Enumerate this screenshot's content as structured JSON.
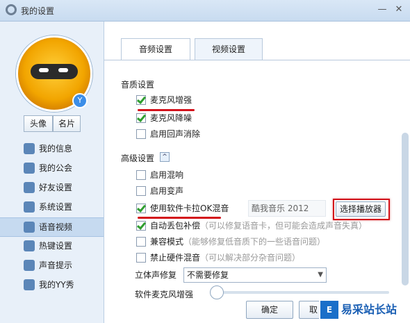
{
  "window": {
    "title": "我的设置",
    "minimize_glyph": "—",
    "close_glyph": "✕"
  },
  "sidebar": {
    "avatar_badge": "Y",
    "buttons": [
      "头像",
      "名片"
    ],
    "items": [
      {
        "label": "我的信息",
        "icon": "user-card-icon"
      },
      {
        "label": "我的公会",
        "icon": "flag-icon"
      },
      {
        "label": "好友设置",
        "icon": "friends-icon"
      },
      {
        "label": "系统设置",
        "icon": "gear-icon"
      },
      {
        "label": "语音视频",
        "icon": "webcam-icon"
      },
      {
        "label": "热键设置",
        "icon": "keyboard-icon"
      },
      {
        "label": "声音提示",
        "icon": "music-note-icon"
      },
      {
        "label": "我的YY秀",
        "icon": "shirt-icon"
      }
    ],
    "active_index": 4
  },
  "tabs": [
    "音频设置",
    "视频设置"
  ],
  "sections": {
    "quality": {
      "title": "音质设置",
      "options": [
        {
          "label": "麦克风增强",
          "checked": true
        },
        {
          "label": "麦克风降噪",
          "checked": true
        },
        {
          "label": "启用回声消除",
          "checked": false
        }
      ]
    },
    "advanced": {
      "title": "高级设置",
      "toggle_glyph": "^",
      "options": [
        {
          "label": "启用混响",
          "checked": false
        },
        {
          "label": "启用变声",
          "checked": false
        },
        {
          "label": "使用软件卡拉OK混音",
          "checked": true
        },
        {
          "label": "自动丢包补偿",
          "hint": "（可以修复语音卡，但可能会造成声音失真）",
          "checked": true
        },
        {
          "label": "兼容模式",
          "hint": "（能够修复低音质下的一些语音问题）",
          "checked": false
        },
        {
          "label": "禁止硬件混音",
          "hint": "（可以解决部分杂音问题）",
          "checked": false
        }
      ],
      "player_value": "酷我音乐 2012",
      "choose_player_button": "选择播放器",
      "stereo_label": "立体声修复",
      "stereo_value": "不需要修复",
      "mic_boost_label": "软件麦克风增强"
    }
  },
  "footer": {
    "ok": "确定",
    "cancel": "取"
  },
  "watermark": {
    "text": "易采站长站",
    "logo": "E"
  }
}
